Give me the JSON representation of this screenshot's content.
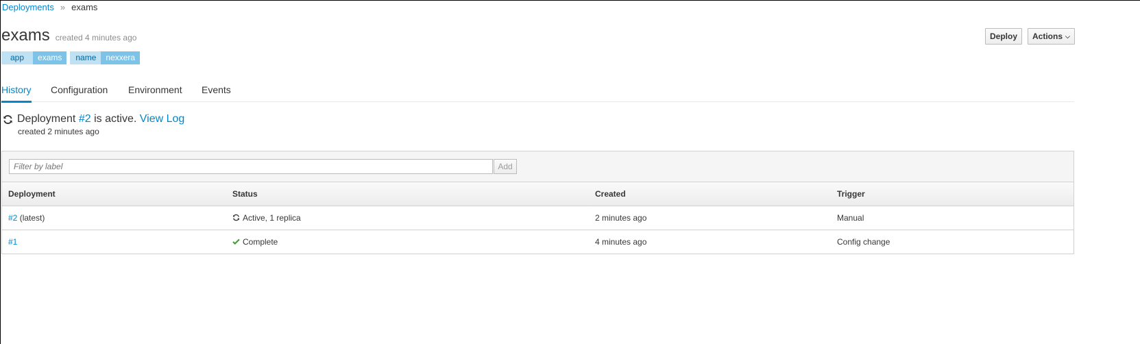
{
  "breadcrumb": {
    "parent": "Deployments",
    "separator": "»",
    "current": "exams"
  },
  "header": {
    "title": "exams",
    "created": "created 4 minutes ago"
  },
  "labels": [
    {
      "key": "app",
      "value": "exams"
    },
    {
      "key": "name",
      "value": "nexxera"
    }
  ],
  "buttons": {
    "deploy": "Deploy",
    "actions": "Actions"
  },
  "tabs": [
    {
      "label": "History",
      "active": true
    },
    {
      "label": "Configuration",
      "active": false
    },
    {
      "label": "Environment",
      "active": false
    },
    {
      "label": "Events",
      "active": false
    }
  ],
  "status": {
    "prefix": "Deployment",
    "deployment_link": "#2",
    "suffix": "is active.",
    "view_log": "View Log",
    "created": "created 2 minutes ago"
  },
  "filter": {
    "placeholder": "Filter by label",
    "add_label": "Add"
  },
  "table": {
    "headers": [
      "Deployment",
      "Status",
      "Created",
      "Trigger"
    ],
    "rows": [
      {
        "deployment": "#2",
        "deployment_note": "(latest)",
        "status_icon": "refresh-icon",
        "status": "Active, 1 replica",
        "created": "2 minutes ago",
        "trigger": "Manual"
      },
      {
        "deployment": "#1",
        "deployment_note": "",
        "status_icon": "check-icon",
        "status": "Complete",
        "created": "4 minutes ago",
        "trigger": "Config change"
      }
    ]
  },
  "colors": {
    "link": "#0088ce",
    "label_key_bg": "#bee1f4",
    "label_val_bg": "#7dc3e8",
    "success": "#3f9c35"
  }
}
